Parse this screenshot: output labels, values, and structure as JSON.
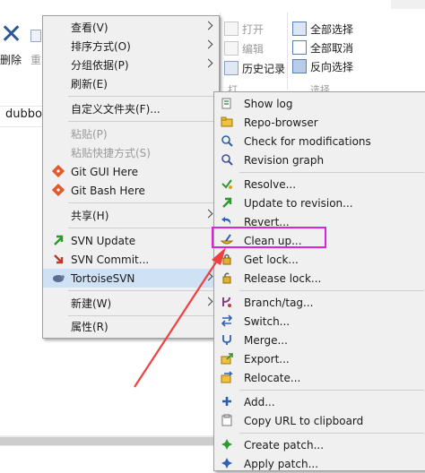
{
  "ribbon": {
    "delete_label": "删除",
    "rename_partial": "重",
    "open_label": "打开",
    "edit_label": "编辑",
    "history_label": "历史记录",
    "select_all": "全部选择",
    "select_none": "全部取消",
    "invert_select": "反向选择",
    "select_group": "选择",
    "open_group_partial": "打"
  },
  "address": {
    "text": "dubbo"
  },
  "main_menu": {
    "items": [
      {
        "label": "查看(V)"
      },
      {
        "label": "排序方式(O)"
      },
      {
        "label": "分组依据(P)"
      },
      {
        "label": "刷新(E)"
      },
      {
        "label": "自定义文件夹(F)..."
      },
      {
        "label": "粘贴(P)"
      },
      {
        "label": "粘贴快捷方式(S)"
      },
      {
        "label": "Git GUI Here"
      },
      {
        "label": "Git Bash Here"
      },
      {
        "label": "共享(H)"
      },
      {
        "label": "SVN Update"
      },
      {
        "label": "SVN Commit..."
      },
      {
        "label": "TortoiseSVN"
      },
      {
        "label": "新建(W)"
      },
      {
        "label": "属性(R)"
      }
    ]
  },
  "svn_menu": {
    "items": [
      {
        "label": "Show log"
      },
      {
        "label": "Repo-browser"
      },
      {
        "label": "Check for modifications"
      },
      {
        "label": "Revision graph"
      },
      {
        "label": "Resolve..."
      },
      {
        "label": "Update to revision..."
      },
      {
        "label": "Revert..."
      },
      {
        "label": "Clean up..."
      },
      {
        "label": "Get lock..."
      },
      {
        "label": "Release lock..."
      },
      {
        "label": "Branch/tag..."
      },
      {
        "label": "Switch..."
      },
      {
        "label": "Merge..."
      },
      {
        "label": "Export..."
      },
      {
        "label": "Relocate..."
      },
      {
        "label": "Add..."
      },
      {
        "label": "Copy URL to clipboard"
      },
      {
        "label": "Create patch..."
      },
      {
        "label": "Apply patch..."
      }
    ]
  },
  "colors": {
    "highlight_box": "#e020e0",
    "arrow": "#f04040",
    "menu_bg": "#f0f0f0",
    "hover": "#cfe1f5"
  }
}
